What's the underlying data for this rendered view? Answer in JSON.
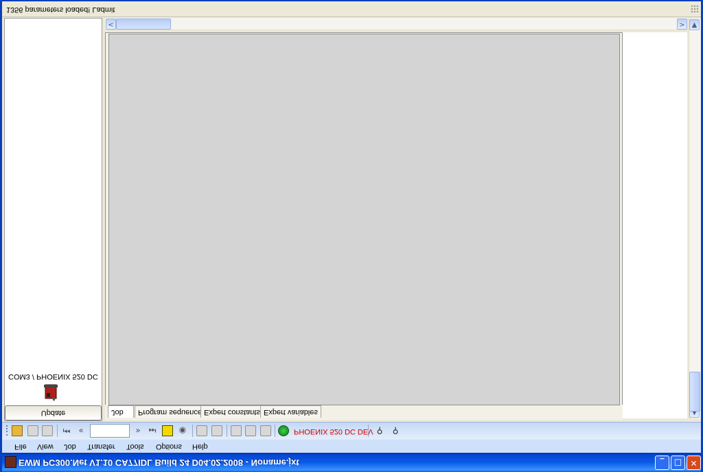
{
  "window": {
    "title": "EWM PC300.Net V1.10 CA77IDL Build 24 D04.02.2008 - Noname.jxt",
    "buttons": {
      "minimize": "minimize",
      "maximize": "maximize",
      "close": "close"
    }
  },
  "menu": [
    "File",
    "View",
    "Job",
    "Transfer",
    "Tools",
    "Options",
    "Help"
  ],
  "toolbar": {
    "device_label": "PHOENIX 520 DC DEV",
    "icons": [
      "open-icon",
      "save-icon",
      "print-icon",
      "first-icon",
      "previous-icon",
      "next-icon",
      "last-icon",
      "program-icon",
      "sound-icon",
      "align-left-icon",
      "image-icon",
      "align-center-icon",
      "align-split-icon",
      "align-right-icon",
      "online-icon",
      "probe-icon",
      "probe2-icon"
    ]
  },
  "left_panel": {
    "update_button": "Update",
    "connection_label": "COM3 / PHOENIX 520 DC"
  },
  "tabs": [
    "Job",
    "Program sequence",
    "Expert constants",
    "Expert variables"
  ],
  "status": {
    "text": "1356 parameters loaded!  Ladmit"
  },
  "colors": {
    "titlebar": "#0a59ea",
    "menubar": "#cfe1fa",
    "canvas": "#d4d4d4",
    "device_label": "#d40000"
  }
}
